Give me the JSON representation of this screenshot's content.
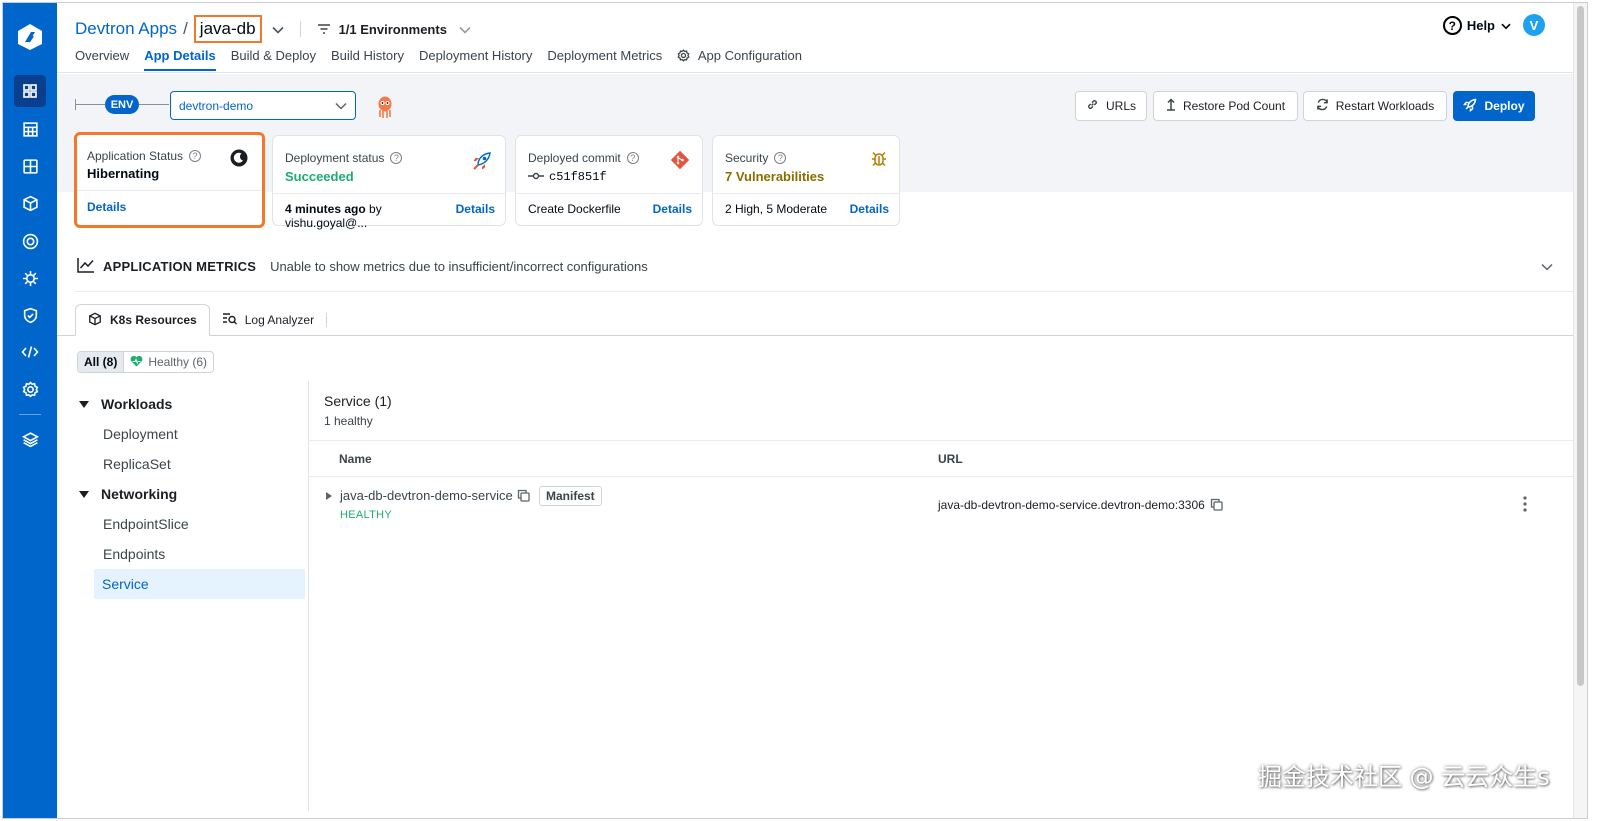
{
  "nav": {
    "icons": [
      "devtron-logo-icon",
      "apps-grid-icon",
      "chart-icon",
      "dashboard-icon",
      "cube-icon",
      "target-icon",
      "bug-icon",
      "shield-icon",
      "code-icon",
      "settings-icon",
      "layers-icon"
    ]
  },
  "header": {
    "breadcrumb_root": "Devtron Apps",
    "breadcrumb_sep": "/",
    "app_name": "java-db",
    "env_filter": "1/1 Environments",
    "help": "Help",
    "avatar": "V",
    "tabs": [
      "Overview",
      "App Details",
      "Build & Deploy",
      "Build History",
      "Deployment History",
      "Deployment Metrics",
      "App Configuration"
    ],
    "active_tab": "App Details"
  },
  "env": {
    "pill": "ENV",
    "selected": "devtron-demo"
  },
  "actions": {
    "urls": "URLs",
    "restore": "Restore Pod Count",
    "restart": "Restart Workloads",
    "deploy": "Deploy"
  },
  "cards": {
    "app_status": {
      "title": "Application Status",
      "value": "Hibernating",
      "link": "Details"
    },
    "deploy_status": {
      "title": "Deployment status",
      "value": "Succeeded",
      "time": "4 minutes ago",
      "by": "by vishu.goyal@...",
      "link": "Details"
    },
    "commit": {
      "title": "Deployed commit",
      "value": "c51f851f",
      "message": "Create Dockerfile",
      "link": "Details"
    },
    "security": {
      "title": "Security",
      "value": "7 Vulnerabilities",
      "summary": "2 High, 5 Moderate",
      "link": "Details"
    }
  },
  "metrics": {
    "title": "APPLICATION METRICS",
    "message": "Unable to show metrics due to insufficient/incorrect configurations"
  },
  "k8s": {
    "tabs": [
      "K8s Resources",
      "Log Analyzer"
    ],
    "filter_all": "All (8)",
    "filter_healthy": "Healthy (6)",
    "tree": {
      "workloads": "Workloads",
      "deployment": "Deployment",
      "replicaset": "ReplicaSet",
      "networking": "Networking",
      "endpointslice": "EndpointSlice",
      "endpoints": "Endpoints",
      "service": "Service"
    }
  },
  "service": {
    "title": "Service (1)",
    "subtitle": "1 healthy",
    "col_name": "Name",
    "col_url": "URL",
    "rows": [
      {
        "name": "java-db-devtron-demo-service",
        "manifest": "Manifest",
        "status": "HEALTHY",
        "url": "java-db-devtron-demo-service.devtron-demo:3306"
      }
    ]
  },
  "watermark": "掘金技术社区 @ 云云众生s",
  "colors": {
    "primary": "#0066cc",
    "success": "#1dad70",
    "warning": "#8a6d00",
    "highlight": "#f07a2c"
  }
}
